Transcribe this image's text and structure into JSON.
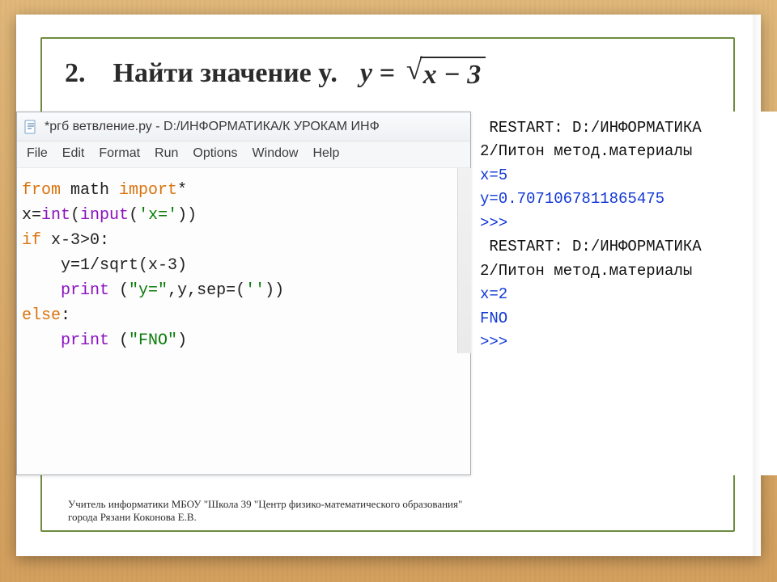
{
  "heading": {
    "number": "2.",
    "title": "Найти значение y.",
    "formula_lhs": "y  =",
    "formula_radicand": "x − 3"
  },
  "editor": {
    "title": "*ргб ветвление.ру - D:/ИНФОРМАТИКА/К УРОКАМ ИНФ",
    "menu": {
      "file": "File",
      "edit": "Edit",
      "format": "Format",
      "run": "Run",
      "options": "Options",
      "window": "Window",
      "help": "Help"
    },
    "code": {
      "l1_from": "from",
      "l1_math": " math ",
      "l1_import": "import",
      "l1_star": "*",
      "l2_a": "x=",
      "l2_int": "int",
      "l2_b": "(",
      "l2_input": "input",
      "l2_c": "(",
      "l2_str": "'x='",
      "l2_d": "))",
      "l3_if": "if",
      "l3_cond": " x-3>0:",
      "l4": "    y=1/sqrt(x-3)",
      "l5_a": "    ",
      "l5_print": "print",
      "l5_b": " (",
      "l5_s1": "\"y=\"",
      "l5_c": ",y,sep=(",
      "l5_s2": "''",
      "l5_d": "))",
      "l6_else": "else",
      "l6_colon": ":",
      "l7_a": "    ",
      "l7_print": "print",
      "l7_b": " (",
      "l7_s": "\"FNO\"",
      "l7_c": ")"
    }
  },
  "console": {
    "r1": " RESTART: D:/ИНФОРМАТИКА",
    "r2": "2/Питон метод.материалы",
    "x1": "x=5",
    "y1": "y=0.7071067811865475",
    "p1": ">>> ",
    "r3": " RESTART: D:/ИНФОРМАТИКА",
    "r4": "2/Питон метод.материалы",
    "x2": "x=2",
    "fno": "FNO",
    "p2": ">>> "
  },
  "footer": {
    "line1": "Учитель информатики МБОУ \"Школа 39 \"Центр физико-математического образования\"",
    "line2": "города Рязани Коконова Е.В."
  }
}
